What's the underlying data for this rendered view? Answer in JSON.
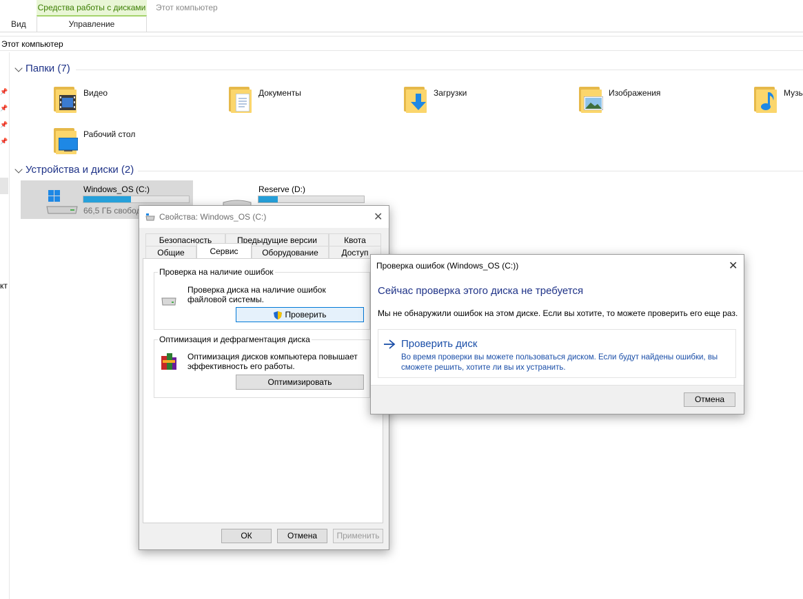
{
  "ribbon": {
    "context_tab": "Средства работы с дисками",
    "context_sub": "Управление",
    "window_title": "Этот компьютер",
    "tab_view": "Вид"
  },
  "address": "Этот компьютер",
  "folders_group": {
    "header": "Папки (7)",
    "items": [
      {
        "label": "Видео",
        "icon": "video-folder-icon"
      },
      {
        "label": "Документы",
        "icon": "documents-folder-icon"
      },
      {
        "label": "Загрузки",
        "icon": "downloads-folder-icon"
      },
      {
        "label": "Изображения",
        "icon": "pictures-folder-icon"
      },
      {
        "label": "Музы",
        "icon": "music-folder-icon"
      },
      {
        "label": "Рабочий стол",
        "icon": "desktop-folder-icon"
      }
    ]
  },
  "devices_group": {
    "header": "Устройства и диски (2)",
    "drives": [
      {
        "label": "Windows_OS (C:)",
        "free": "66,5 ГБ свобод",
        "usage": 0.45
      },
      {
        "label": "Reserve (D:)",
        "usage": 0.18
      }
    ]
  },
  "nav_partial": "кт",
  "properties": {
    "title": "Свойства: Windows_OS (C:)",
    "tabs_row1": [
      "Безопасность",
      "Предыдущие версии",
      "Квота"
    ],
    "tabs_row2": [
      "Общие",
      "Сервис",
      "Оборудование",
      "Доступ"
    ],
    "check_group": {
      "title": "Проверка на наличие ошибок",
      "text": "Проверка диска на наличие ошибок файловой системы.",
      "button": "Проверить"
    },
    "defrag_group": {
      "title": "Оптимизация и дефрагментация диска",
      "text": "Оптимизация дисков компьютера повышает эффективность его работы.",
      "button": "Оптимизировать"
    },
    "buttons": {
      "ok": "ОК",
      "cancel": "Отмена",
      "apply": "Применить"
    }
  },
  "error_check": {
    "title": "Проверка ошибок (Windows_OS (C:))",
    "heading": "Сейчас проверка этого диска не требуется",
    "message": "Мы не обнаружили ошибок на этом диске. Если вы хотите, то можете проверить его еще раз.",
    "link_title": "Проверить диск",
    "link_desc_1": "Во время проверки вы можете пользоваться диском. Если будут найдены ошибки, вы",
    "link_desc_2": "сможете решить, хотите ли вы их устранить.",
    "cancel": "Отмена"
  },
  "colors": {
    "accent": "#0078d7",
    "heading_blue": "#1e3287",
    "link_blue": "#1a4ea8",
    "bar_fill": "#26a0da"
  }
}
